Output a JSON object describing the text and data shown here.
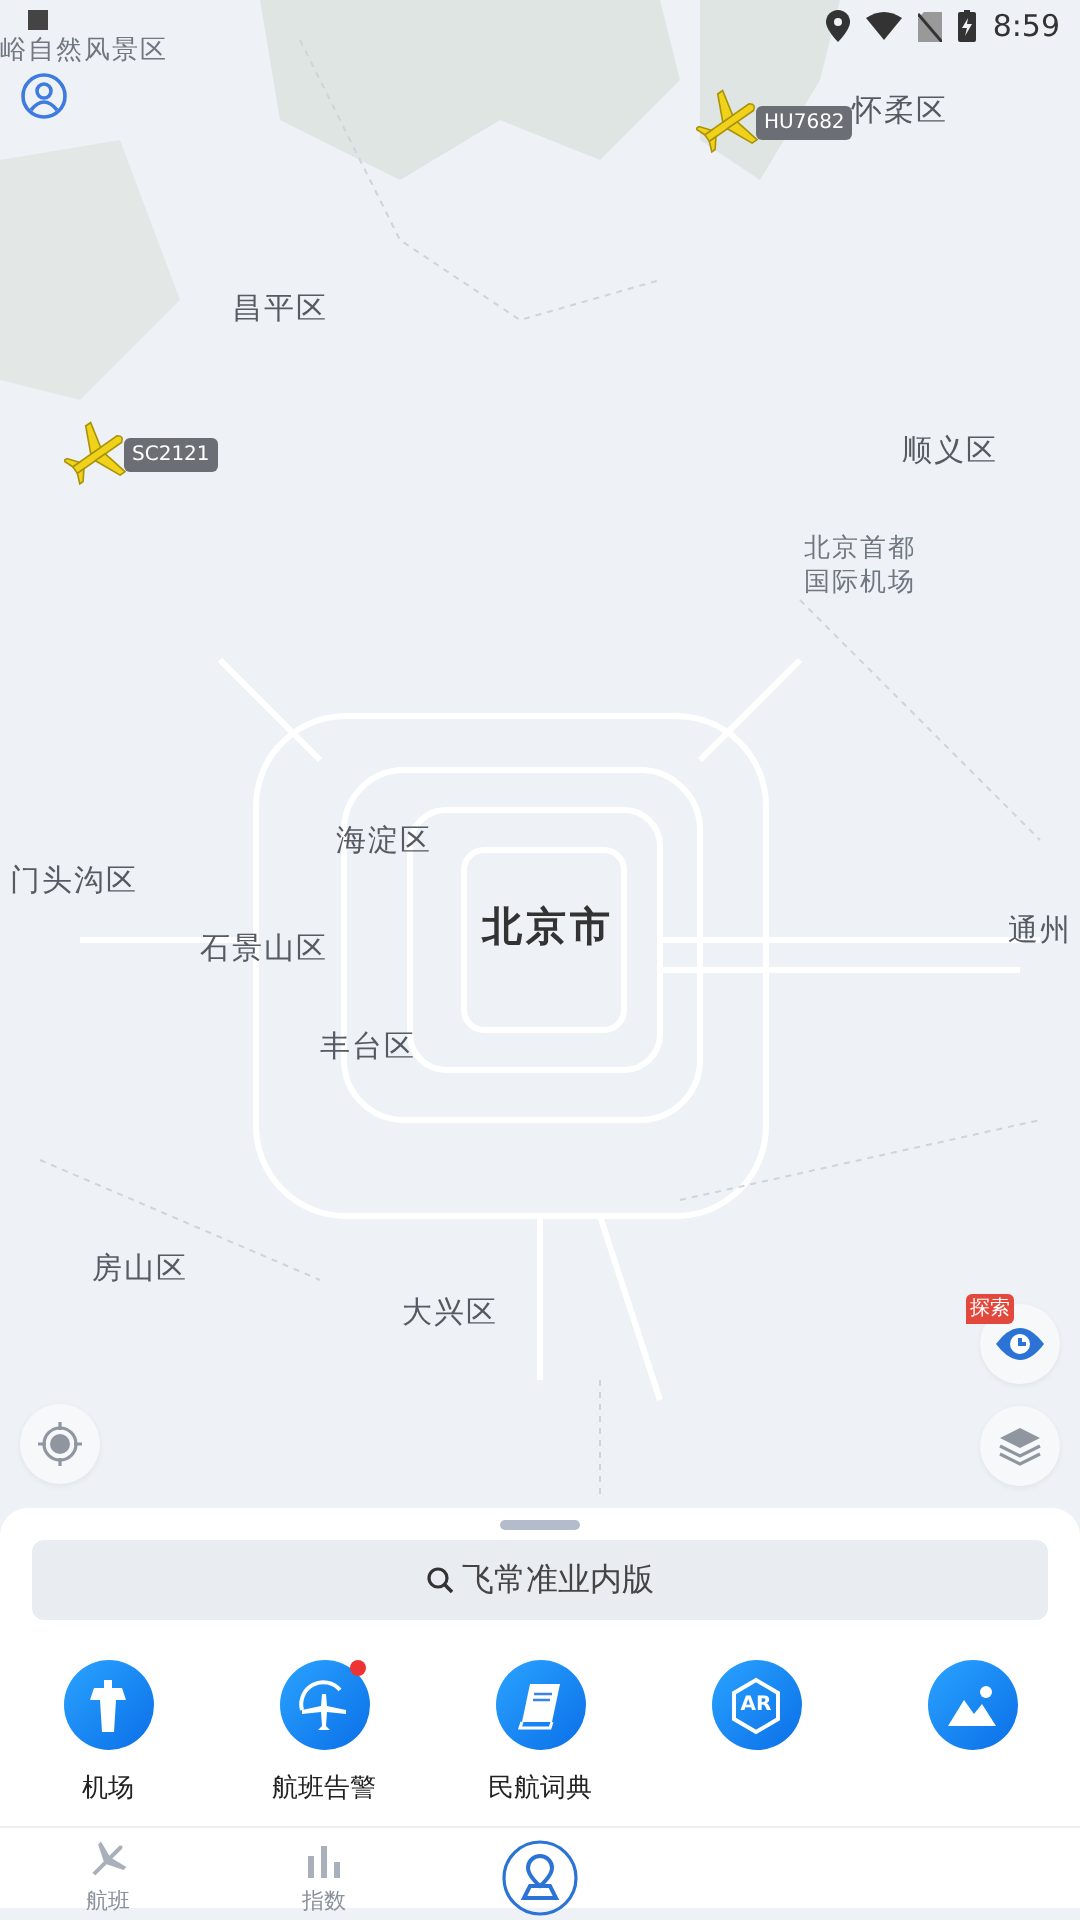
{
  "status_bar": {
    "time": "8:59"
  },
  "map": {
    "labels": [
      {
        "text": "峪自然风景区",
        "kind": "poi"
      },
      {
        "text": "怀柔区",
        "kind": "district"
      },
      {
        "text": "昌平区",
        "kind": "district"
      },
      {
        "text": "顺义区",
        "kind": "district"
      },
      {
        "text": "北京首都国际机场",
        "kind": "poi"
      },
      {
        "text": "海淀区",
        "kind": "district"
      },
      {
        "text": "门头沟区",
        "kind": "district"
      },
      {
        "text": "北京市",
        "kind": "city"
      },
      {
        "text": "通州",
        "kind": "district"
      },
      {
        "text": "石景山区",
        "kind": "district"
      },
      {
        "text": "丰台区",
        "kind": "district"
      },
      {
        "text": "房山区",
        "kind": "district"
      },
      {
        "text": "大兴区",
        "kind": "district"
      }
    ],
    "flights": [
      {
        "callsign": "HU7682"
      },
      {
        "callsign": "SC2121"
      }
    ],
    "explore_badge": "探索"
  },
  "search": {
    "placeholder": "飞常准业内版"
  },
  "shortcuts": [
    {
      "kind": "tower",
      "label": "机场",
      "alert": false
    },
    {
      "kind": "alert-plane",
      "label": "航班告警",
      "alert": true
    },
    {
      "kind": "book",
      "label": "民航词典",
      "alert": false
    },
    {
      "kind": "ar",
      "text": "AR",
      "alert": false
    },
    {
      "kind": "mountain",
      "alert": false
    }
  ],
  "bottom_nav": [
    {
      "kind": "plane",
      "label": "航班",
      "selected": false
    },
    {
      "kind": "chart",
      "label": "指数",
      "selected": false
    },
    {
      "kind": "map",
      "selected": true
    }
  ]
}
